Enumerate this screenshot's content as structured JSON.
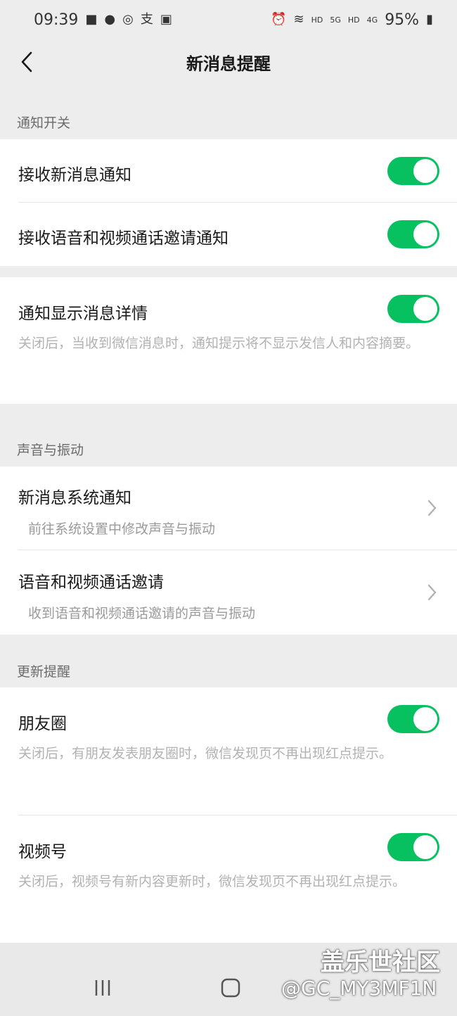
{
  "status": {
    "time": "09:39",
    "battery": "95%",
    "left_icons": [
      "chat-icon",
      "shield-icon",
      "check-circle-icon",
      "alipay-icon",
      "image-icon"
    ],
    "right_icons": [
      "alarm-icon",
      "wifi-icon",
      "hd-signal-icon",
      "hd-signal-icon",
      "battery-icon"
    ],
    "net1": "HD",
    "net2": "5G",
    "net3": "HD",
    "net4": "4G"
  },
  "nav": {
    "title": "新消息提醒"
  },
  "sections": {
    "notify_header": "通知开关",
    "sound_header": "声音与振动",
    "update_header": "更新提醒"
  },
  "items": {
    "receive_new": {
      "title": "接收新消息通知",
      "on": true
    },
    "receive_call": {
      "title": "接收语音和视频通话邀请通知",
      "on": true
    },
    "show_detail": {
      "title": "通知显示消息详情",
      "desc": "关闭后，当收到微信消息时，通知提示将不显示发信人和内容摘要。",
      "on": true
    },
    "sys_notify": {
      "title": "新消息系统通知",
      "sub": "前往系统设置中修改声音与振动"
    },
    "call_invite": {
      "title": "语音和视频通话邀请",
      "sub": "收到语音和视频通话邀请的声音与振动"
    },
    "moments": {
      "title": "朋友圈",
      "desc": "关闭后，有朋友发表朋友圈时，微信发现页不再出现红点提示。",
      "on": true
    },
    "channels": {
      "title": "视频号",
      "desc": "关闭后，视频号有新内容更新时，微信发现页不再出现红点提示。",
      "on": true
    }
  },
  "watermark": {
    "line1": "盖乐世社区",
    "line2": "@GC_MY3MF1N"
  },
  "colors": {
    "accent": "#07c160",
    "background": "#ededed"
  }
}
